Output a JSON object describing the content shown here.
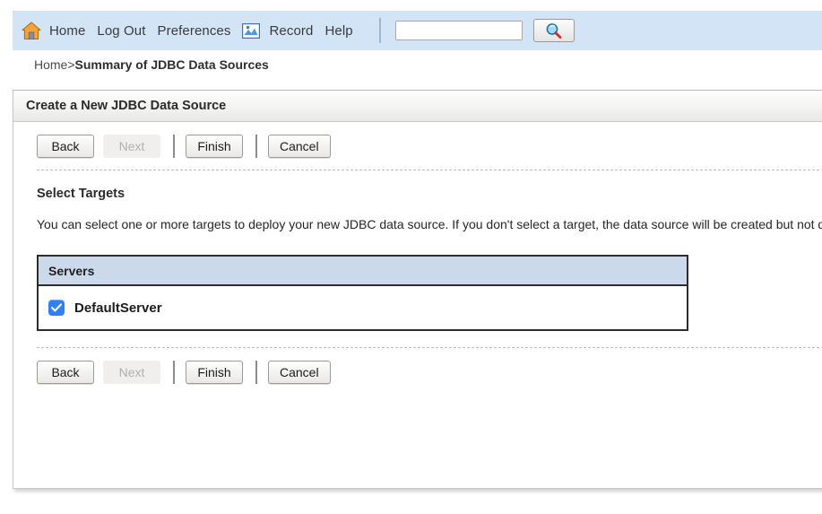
{
  "toolbar": {
    "home_icon": "home-icon",
    "links": [
      {
        "label": "Home"
      },
      {
        "label": "Log Out"
      },
      {
        "label": "Preferences"
      }
    ],
    "record_icon": "image-chart-icon",
    "record_label": "Record",
    "help_label": "Help",
    "search": {
      "value": "",
      "placeholder": ""
    },
    "search_icon": "magnifier-icon",
    "accent_color": "#d4e4f7"
  },
  "breadcrumb": {
    "home": "Home",
    "separator": ">",
    "current": "Summary of JDBC Data Sources"
  },
  "panel": {
    "title": "Create a New JDBC Data Source"
  },
  "buttons": {
    "back": "Back",
    "next": "Next",
    "finish": "Finish",
    "cancel": "Cancel",
    "next_disabled": true
  },
  "section": {
    "heading": "Select Targets",
    "description": "You can select one or more targets to deploy your new JDBC data source. If you don't select a target, the data source will be created but not deployed. You will need to deploy the data source at a later time."
  },
  "servers_table": {
    "columns": [
      "Servers"
    ],
    "rows": [
      {
        "checked": true,
        "name": "DefaultServer"
      }
    ]
  },
  "colors": {
    "toolbar_blue": "#d4e4f7",
    "table_header_blue": "#ccd9ea",
    "checkbox_blue": "#2f7ff5"
  }
}
